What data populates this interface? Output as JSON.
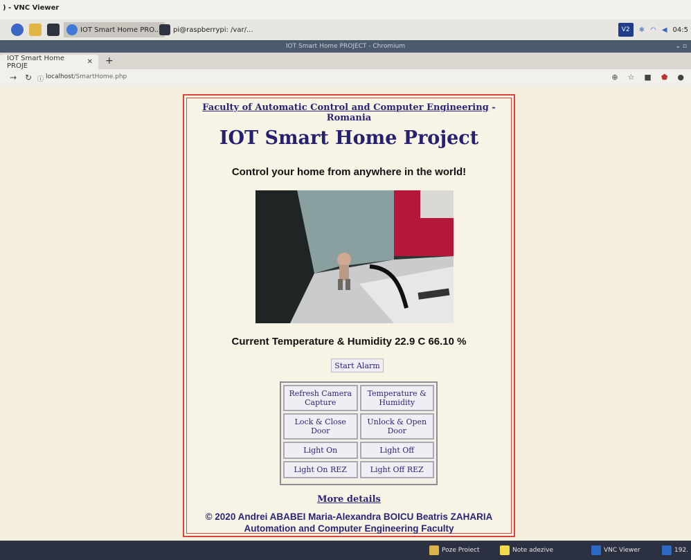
{
  "vnc": {
    "title": ") - VNC Viewer"
  },
  "pi_panel": {
    "tasks": [
      {
        "label": "IOT Smart Home PRO..."
      },
      {
        "label": "pi@raspberrypi: /var/..."
      }
    ],
    "clock": "04:5"
  },
  "browser": {
    "window_title": "IOT Smart Home PROJECT - Chromium",
    "tab_label": "IOT Smart Home PROJE",
    "url_host": "localhost",
    "url_path": "/SmartHome.php"
  },
  "page": {
    "faculty_link": "Faculty of Automatic Control and Computer Engineering",
    "faculty_suffix": " - Romania",
    "title": "IOT Smart Home Project",
    "subtitle": "Control your home from anywhere in the world!",
    "temperature_text": "Current Temperature & Humidity 22.9 C 66.10 %",
    "alarm_button": "Start Alarm",
    "controls": {
      "refresh_camera": "Refresh Camera Capture",
      "temp_humidity": "Temperature & Humidity",
      "lock_door": "Lock & Close Door",
      "unlock_door": "Unlock & Open Door",
      "light_on": "Light On",
      "light_off": "Light Off",
      "light_on_rez": "Light On REZ",
      "light_off_rez": "Light Off REZ"
    },
    "more_details": "More details",
    "copyright_line1": "© 2020 Andrei ABABEI Maria-Alexandra BOICU Beatris ZAHARIA",
    "copyright_line2": "Automation and Computer Engineering Faculty"
  },
  "taskbar": {
    "items": [
      {
        "label": "Poze Proiect"
      },
      {
        "label": "Note adezive"
      },
      {
        "label": "VNC Viewer"
      },
      {
        "label": "192."
      }
    ]
  },
  "colors": {
    "accent": "#2a2578",
    "border": "#d9433a"
  }
}
